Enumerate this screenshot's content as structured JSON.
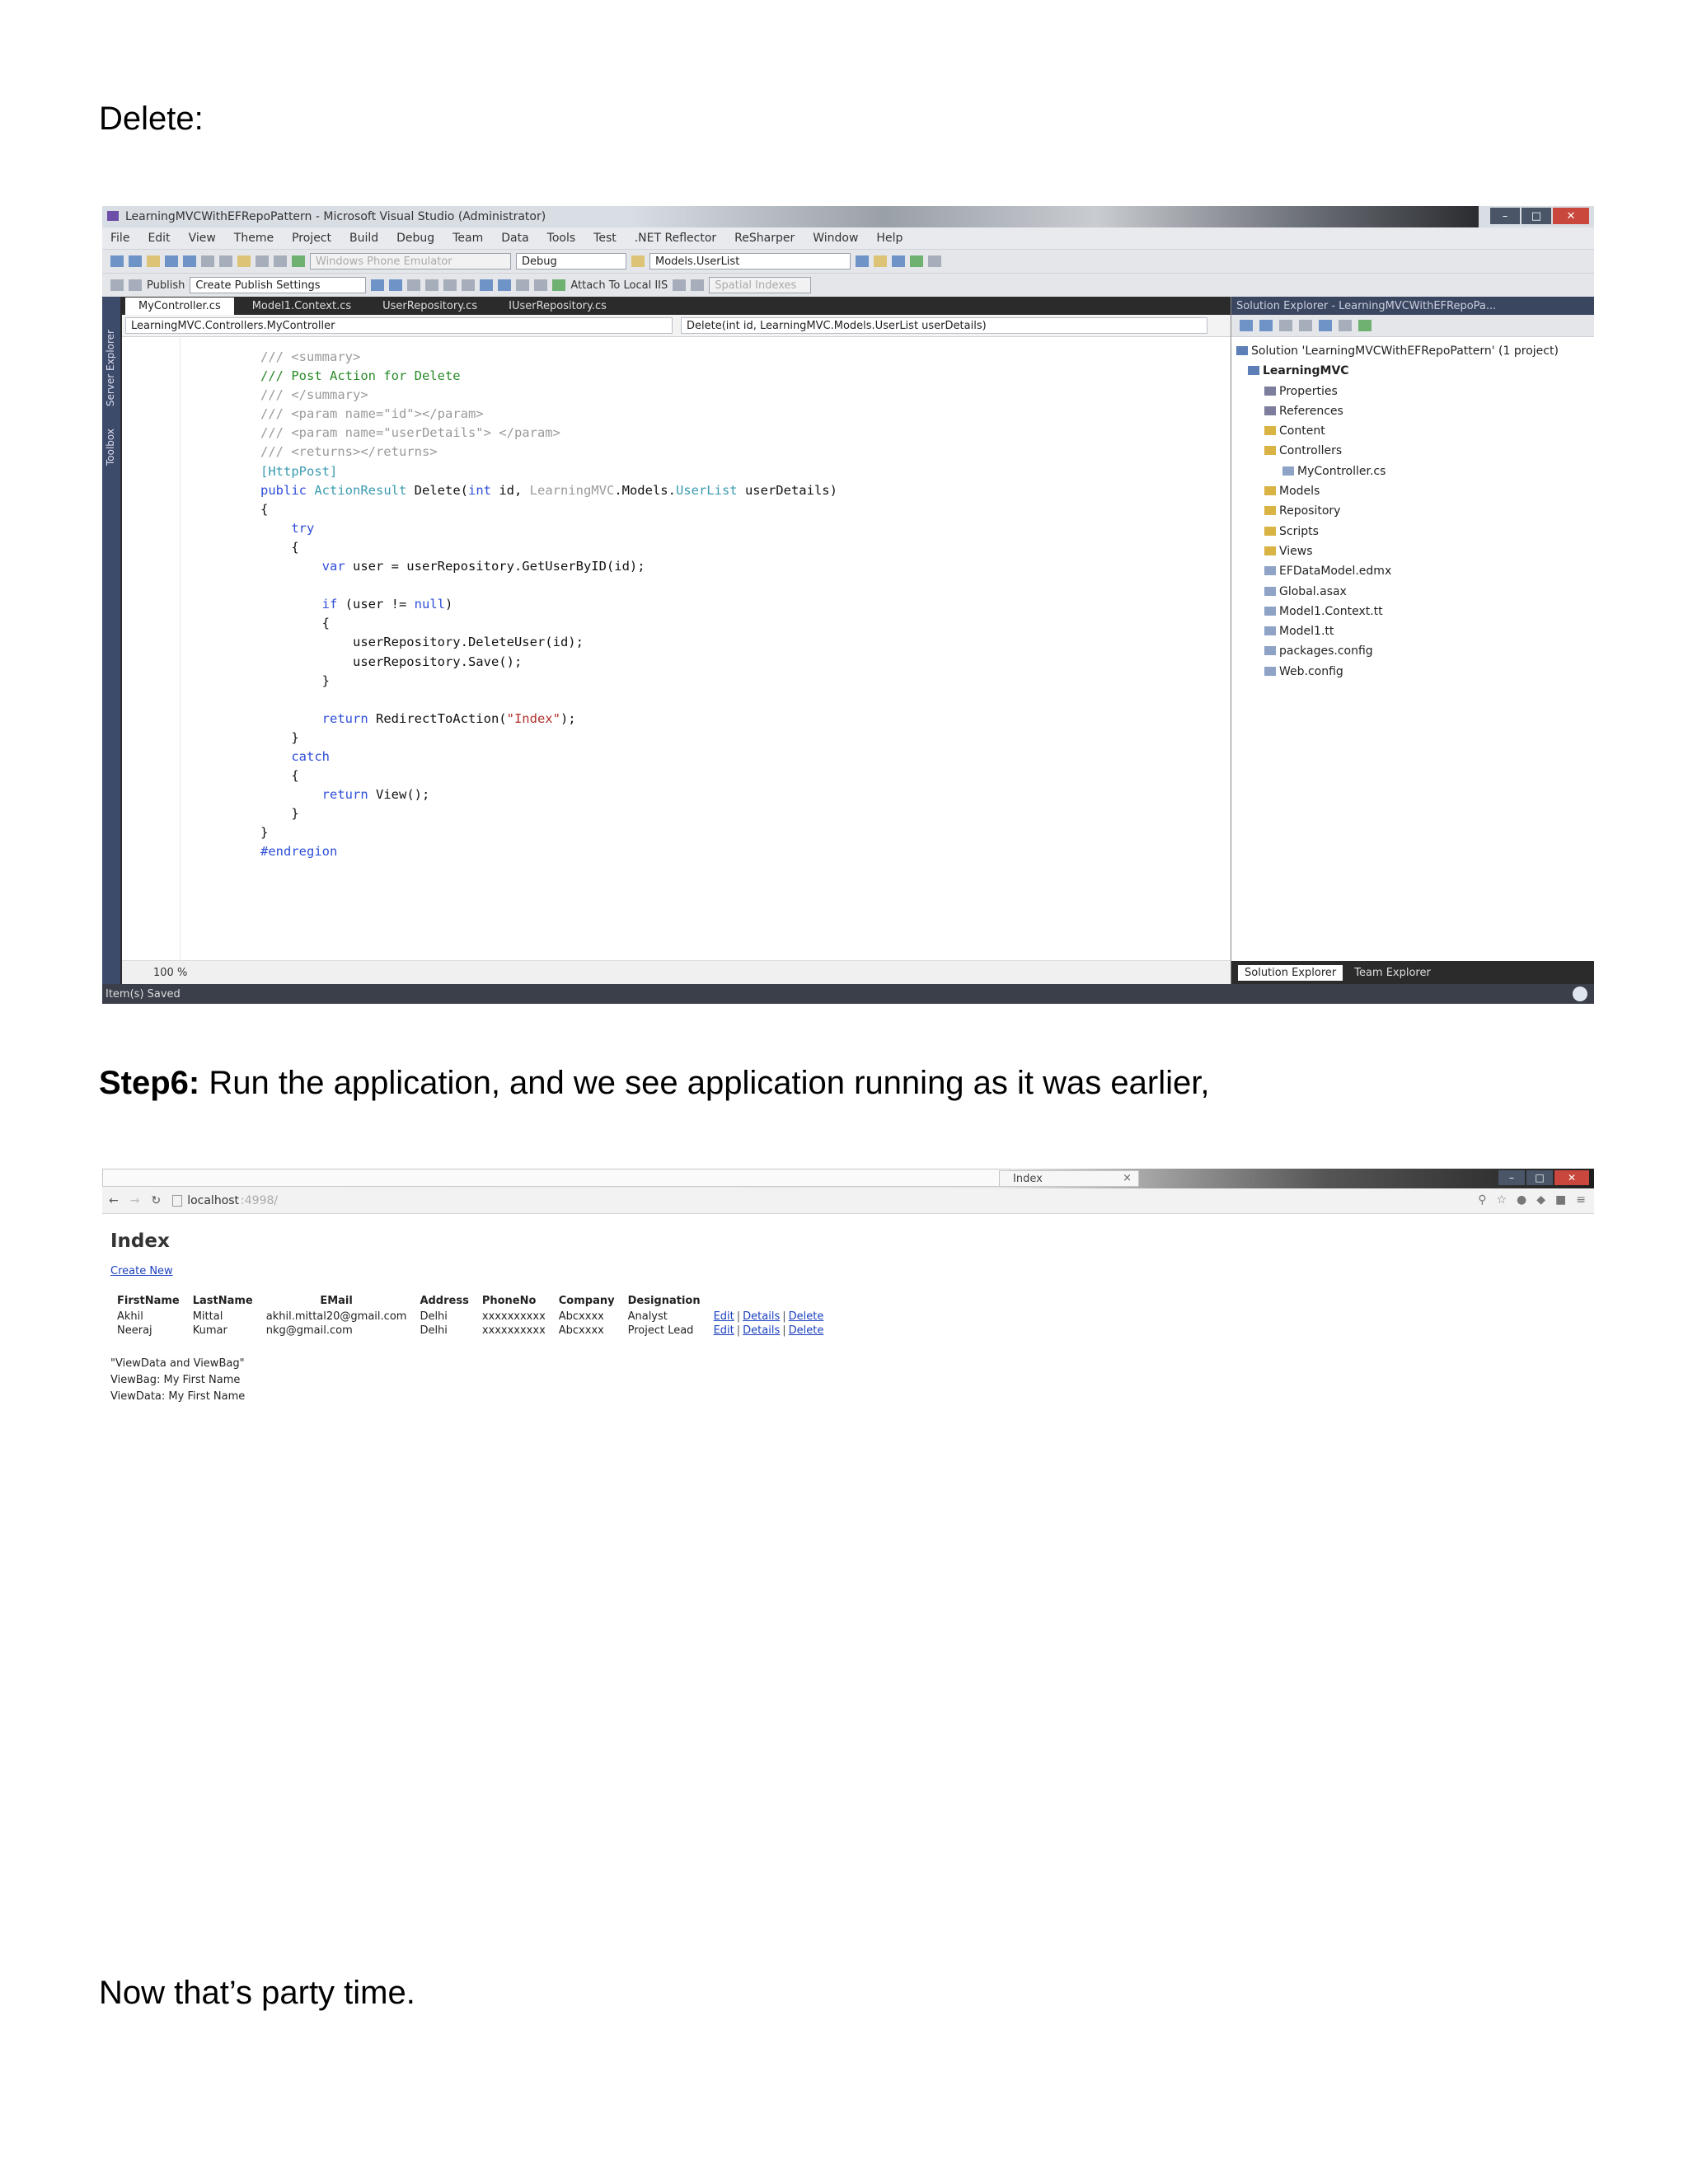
{
  "heading_delete": "Delete:",
  "step6": {
    "bold": "Step6:",
    "text": " Run the application, and we see application running as it was earlier,"
  },
  "closing": "Now that’s party time.",
  "vs": {
    "title": "LearningMVCWithEFRepoPattern - Microsoft Visual Studio (Administrator)",
    "menu": [
      "File",
      "Edit",
      "View",
      "Theme",
      "Project",
      "Build",
      "Debug",
      "Team",
      "Data",
      "Tools",
      "Test",
      ".NET Reflector",
      "ReSharper",
      "Window",
      "Help"
    ],
    "emulator": "Windows Phone Emulator",
    "config": "Debug",
    "model_combo": "Models.UserList",
    "publish_label": "Publish",
    "publish_settings": "Create Publish Settings",
    "attach_label": "Attach To Local IIS",
    "spatial_label": "Spatial Indexes",
    "side_tabs": [
      "Server Explorer",
      "Toolbox"
    ],
    "tabs": [
      "MyController.cs",
      "Model1.Context.cs",
      "UserRepository.cs",
      "IUserRepository.cs"
    ],
    "nav_left": "LearningMVC.Controllers.MyController",
    "nav_right": "Delete(int id, LearningMVC.Models.UserList userDetails)",
    "code": {
      "summary_open": "/// <summary>",
      "summary_text": "/// Post Action for Delete",
      "summary_close": "/// </summary>",
      "param_id": "/// <param name=\"id\"></param>",
      "param_details": "/// <param name=\"userDetails\"> </param>",
      "returns": "/// <returns></returns>",
      "attr": "[HttpPost]",
      "sig_public": "public",
      "sig_type": "ActionResult",
      "sig_name": " Delete(",
      "sig_int": "int",
      "sig_id": " id, ",
      "sig_ns": "LearningMVC",
      "sig_models": ".Models.",
      "sig_userlist": "UserList",
      "sig_end": " userDetails)",
      "brace_open": "{",
      "brace_close": "}",
      "try": "try",
      "var_kw": "var",
      "var_rest": " user = userRepository.GetUserByID(id);",
      "if_kw": "if",
      "if_mid": " (user != ",
      "if_null": "null",
      "if_end": ")",
      "delete_call": "userRepository.DeleteUser(id);",
      "save_call": "userRepository.Save();",
      "return_kw": "return",
      "redirect_mid": " RedirectToAction(",
      "redirect_arg": "\"Index\"",
      "redirect_end": ");",
      "catch": "catch",
      "view_call": " View();",
      "endregion": "#endregion"
    },
    "zoom": "100 %",
    "solution_header": "Solution Explorer - LearningMVCWithEFRepoPa...",
    "solution_tree": [
      "Solution 'LearningMVCWithEFRepoPattern' (1 project)",
      "LearningMVC",
      "Properties",
      "References",
      "Content",
      "Controllers",
      "MyController.cs",
      "Models",
      "Repository",
      "Scripts",
      "Views",
      "EFDataModel.edmx",
      "Global.asax",
      "Model1.Context.tt",
      "Model1.tt",
      "packages.config",
      "Web.config"
    ],
    "bottom_tabs": [
      "Solution Explorer",
      "Team Explorer"
    ],
    "status": "Item(s) Saved"
  },
  "browser": {
    "tab_title": "Index",
    "url": "localhost",
    "url_port": ":4998/",
    "page_title": "Index",
    "create_link": "Create New",
    "columns": [
      "FirstName",
      "LastName",
      "EMail",
      "Address",
      "PhoneNo",
      "Company",
      "Designation"
    ],
    "rows": [
      [
        "Akhil",
        "Mittal",
        "akhil.mittal20@gmail.com",
        "Delhi",
        "xxxxxxxxxx",
        "Abcxxxx",
        "Analyst"
      ],
      [
        "Neeraj",
        "Kumar",
        "nkg@gmail.com",
        "Delhi",
        "xxxxxxxxxx",
        "Abcxxxx",
        "Project Lead"
      ]
    ],
    "row_links": [
      "Edit",
      "Details",
      "Delete"
    ],
    "link_separator": "|",
    "view_lines": [
      "\"ViewData and ViewBag\"",
      "ViewBag: My First Name",
      "ViewData: My First Name"
    ]
  }
}
